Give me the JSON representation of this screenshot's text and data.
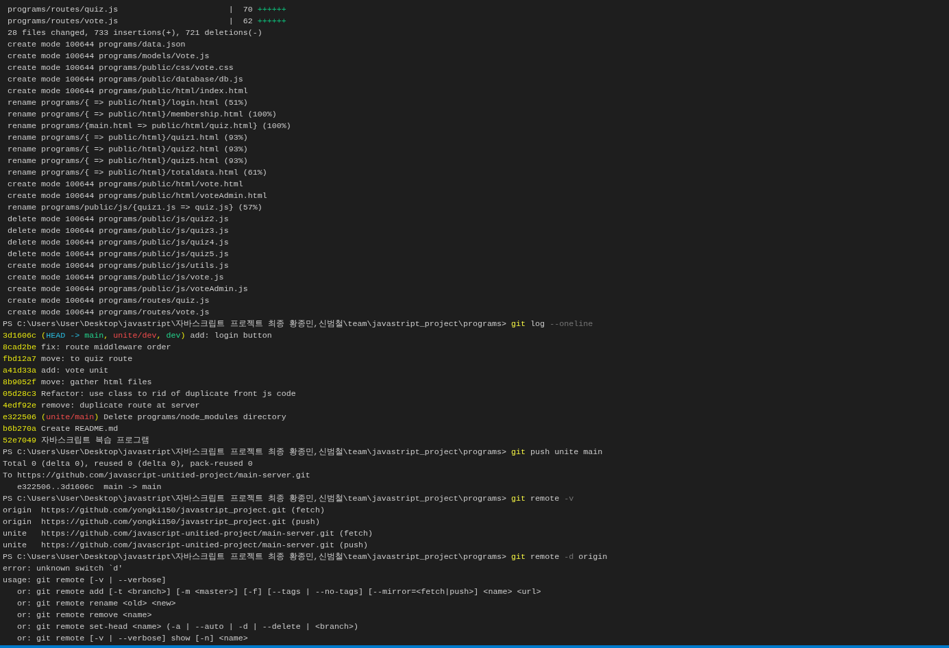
{
  "terminal": {
    "lines": [
      [
        {
          "text": " programs/routes/quiz.js                       |  70 ",
          "kind": "text"
        },
        {
          "text": "++++++",
          "kind": "plus"
        }
      ],
      [
        {
          "text": " programs/routes/vote.js                       |  62 ",
          "kind": "text"
        },
        {
          "text": "++++++",
          "kind": "plus"
        }
      ],
      [
        {
          "text": " 28 files changed, 733 insertions(+), 721 deletions(-)",
          "kind": "text"
        }
      ],
      [
        {
          "text": " create mode 100644 programs/data.json",
          "kind": "text"
        }
      ],
      [
        {
          "text": " create mode 100644 programs/models/Vote.js",
          "kind": "text"
        }
      ],
      [
        {
          "text": " create mode 100644 programs/public/css/vote.css",
          "kind": "text"
        }
      ],
      [
        {
          "text": " create mode 100644 programs/public/database/db.js",
          "kind": "text"
        }
      ],
      [
        {
          "text": " create mode 100644 programs/public/html/index.html",
          "kind": "text"
        }
      ],
      [
        {
          "text": " rename programs/{ => public/html}/login.html (51%)",
          "kind": "text"
        }
      ],
      [
        {
          "text": " rename programs/{ => public/html}/membership.html (100%)",
          "kind": "text"
        }
      ],
      [
        {
          "text": " rename programs/{main.html => public/html/quiz.html} (100%)",
          "kind": "text"
        }
      ],
      [
        {
          "text": " rename programs/{ => public/html}/quiz1.html (93%)",
          "kind": "text"
        }
      ],
      [
        {
          "text": " rename programs/{ => public/html}/quiz2.html (93%)",
          "kind": "text"
        }
      ],
      [
        {
          "text": " rename programs/{ => public/html}/quiz5.html (93%)",
          "kind": "text"
        }
      ],
      [
        {
          "text": " rename programs/{ => public/html}/totaldata.html (61%)",
          "kind": "text"
        }
      ],
      [
        {
          "text": " create mode 100644 programs/public/html/vote.html",
          "kind": "text"
        }
      ],
      [
        {
          "text": " create mode 100644 programs/public/html/voteAdmin.html",
          "kind": "text"
        }
      ],
      [
        {
          "text": " rename programs/public/js/{quiz1.js => quiz.js} (57%)",
          "kind": "text"
        }
      ],
      [
        {
          "text": " delete mode 100644 programs/public/js/quiz2.js",
          "kind": "text"
        }
      ],
      [
        {
          "text": " delete mode 100644 programs/public/js/quiz3.js",
          "kind": "text"
        }
      ],
      [
        {
          "text": " delete mode 100644 programs/public/js/quiz4.js",
          "kind": "text"
        }
      ],
      [
        {
          "text": " delete mode 100644 programs/public/js/quiz5.js",
          "kind": "text"
        }
      ],
      [
        {
          "text": " create mode 100644 programs/public/js/utils.js",
          "kind": "text"
        }
      ],
      [
        {
          "text": " create mode 100644 programs/public/js/vote.js",
          "kind": "text"
        }
      ],
      [
        {
          "text": " create mode 100644 programs/public/js/voteAdmin.js",
          "kind": "text"
        }
      ],
      [
        {
          "text": " create mode 100644 programs/routes/quiz.js",
          "kind": "text"
        }
      ],
      [
        {
          "text": " create mode 100644 programs/routes/vote.js",
          "kind": "text"
        }
      ],
      [
        {
          "text": "PS C:\\Users\\User\\Desktop\\javastript\\자바스크립트 프로젝트 최종 황종민,신범철\\team\\javastript_project\\programs> ",
          "kind": "text"
        },
        {
          "text": "git",
          "kind": "cmd"
        },
        {
          "text": " log ",
          "kind": "text"
        },
        {
          "text": "--oneline",
          "kind": "flag"
        }
      ],
      [
        {
          "text": "3d1606c",
          "kind": "hash"
        },
        {
          "text": " (",
          "kind": "hash"
        },
        {
          "text": "HEAD -> ",
          "kind": "head"
        },
        {
          "text": "main",
          "kind": "local"
        },
        {
          "text": ", ",
          "kind": "hash"
        },
        {
          "text": "unite/dev",
          "kind": "remote"
        },
        {
          "text": ", ",
          "kind": "hash"
        },
        {
          "text": "dev",
          "kind": "local"
        },
        {
          "text": ")",
          "kind": "hash"
        },
        {
          "text": " add: login button",
          "kind": "text"
        }
      ],
      [
        {
          "text": "8cad2be",
          "kind": "hash"
        },
        {
          "text": " fix: route middleware order",
          "kind": "text"
        }
      ],
      [
        {
          "text": "fbd12a7",
          "kind": "hash"
        },
        {
          "text": " move: to quiz route",
          "kind": "text"
        }
      ],
      [
        {
          "text": "a41d33a",
          "kind": "hash"
        },
        {
          "text": " add: vote unit",
          "kind": "text"
        }
      ],
      [
        {
          "text": "8b9052f",
          "kind": "hash"
        },
        {
          "text": " move: gather html files",
          "kind": "text"
        }
      ],
      [
        {
          "text": "05d28c3",
          "kind": "hash"
        },
        {
          "text": " Refactor: use class to rid of duplicate front js code",
          "kind": "text"
        }
      ],
      [
        {
          "text": "4edf92e",
          "kind": "hash"
        },
        {
          "text": " remove: duplicate route at server",
          "kind": "text"
        }
      ],
      [
        {
          "text": "e322506",
          "kind": "hash"
        },
        {
          "text": " (",
          "kind": "hash"
        },
        {
          "text": "unite/main",
          "kind": "remote"
        },
        {
          "text": ")",
          "kind": "hash"
        },
        {
          "text": " Delete programs/node_modules directory",
          "kind": "text"
        }
      ],
      [
        {
          "text": "b6b270a",
          "kind": "hash"
        },
        {
          "text": " Create README.md",
          "kind": "text"
        }
      ],
      [
        {
          "text": "52e7049",
          "kind": "hash"
        },
        {
          "text": " 자바스크립트 복습 프로그램",
          "kind": "text"
        }
      ],
      [
        {
          "text": "PS C:\\Users\\User\\Desktop\\javastript\\자바스크립트 프로젝트 최종 황종민,신범철\\team\\javastript_project\\programs> ",
          "kind": "text"
        },
        {
          "text": "git",
          "kind": "cmd"
        },
        {
          "text": " push unite main",
          "kind": "text"
        }
      ],
      [
        {
          "text": "Total 0 (delta 0), reused 0 (delta 0), pack-reused 0",
          "kind": "text"
        }
      ],
      [
        {
          "text": "To https://github.com/javascript-unitied-project/main-server.git",
          "kind": "text"
        }
      ],
      [
        {
          "text": "   e322506..3d1606c  main -> main",
          "kind": "text"
        }
      ],
      [
        {
          "text": "PS C:\\Users\\User\\Desktop\\javastript\\자바스크립트 프로젝트 최종 황종민,신범철\\team\\javastript_project\\programs> ",
          "kind": "text"
        },
        {
          "text": "git",
          "kind": "cmd"
        },
        {
          "text": " remote ",
          "kind": "text"
        },
        {
          "text": "-v",
          "kind": "flag"
        }
      ],
      [
        {
          "text": "origin  https://github.com/yongki150/javastript_project.git (fetch)",
          "kind": "text"
        }
      ],
      [
        {
          "text": "origin  https://github.com/yongki150/javastript_project.git (push)",
          "kind": "text"
        }
      ],
      [
        {
          "text": "unite   https://github.com/javascript-unitied-project/main-server.git (fetch)",
          "kind": "text"
        }
      ],
      [
        {
          "text": "unite   https://github.com/javascript-unitied-project/main-server.git (push)",
          "kind": "text"
        }
      ],
      [
        {
          "text": "PS C:\\Users\\User\\Desktop\\javastript\\자바스크립트 프로젝트 최종 황종민,신범철\\team\\javastript_project\\programs> ",
          "kind": "text"
        },
        {
          "text": "git",
          "kind": "cmd"
        },
        {
          "text": " remote ",
          "kind": "text"
        },
        {
          "text": "-d",
          "kind": "flag"
        },
        {
          "text": " origin",
          "kind": "text"
        }
      ],
      [
        {
          "text": "error: unknown switch `d'",
          "kind": "text"
        }
      ],
      [
        {
          "text": "usage: git remote [-v | --verbose]",
          "kind": "text"
        }
      ],
      [
        {
          "text": "   or: git remote add [-t <branch>] [-m <master>] [-f] [--tags | --no-tags] [--mirror=<fetch|push>] <name> <url>",
          "kind": "text"
        }
      ],
      [
        {
          "text": "   or: git remote rename <old> <new>",
          "kind": "text"
        }
      ],
      [
        {
          "text": "   or: git remote remove <name>",
          "kind": "text"
        }
      ],
      [
        {
          "text": "   or: git remote set-head <name> (-a | --auto | -d | --delete | <branch>)",
          "kind": "text"
        }
      ],
      [
        {
          "text": "   or: git remote [-v | --verbose] show [-n] <name>",
          "kind": "text"
        }
      ]
    ]
  }
}
